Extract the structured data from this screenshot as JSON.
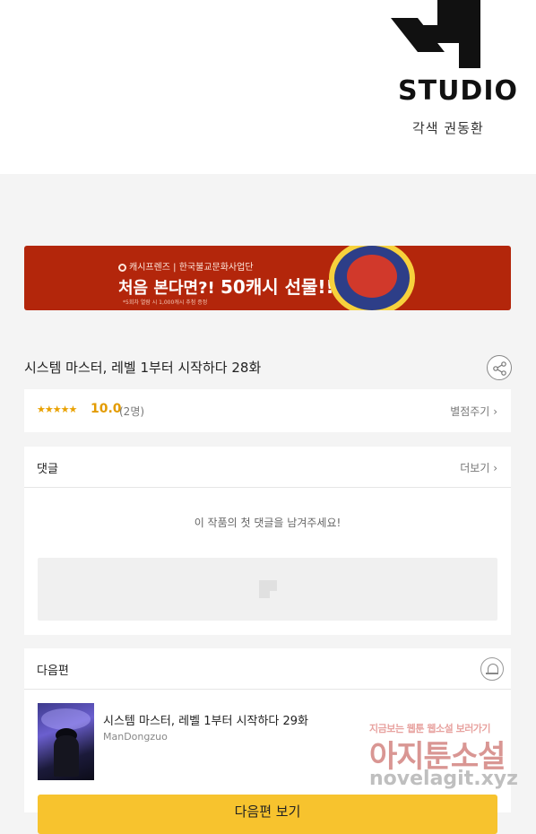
{
  "header": {
    "studio_name": "STUDIO",
    "credit": "각색 권동환"
  },
  "banner": {
    "brand_line": "캐시프렌즈 | 한국불교문화사업단",
    "headline_prefix": "처음 본다면?!",
    "headline_emphasis": "50캐시 선물!!",
    "fine_print": "*5회차 열람 시 1,000캐시 추첨 증정"
  },
  "episode": {
    "title": "시스템 마스터, 레벨 1부터 시작하다 28화"
  },
  "rating": {
    "stars": "★★★★★",
    "score": "10.0",
    "count": "(2명)",
    "rate_link": "별점주기"
  },
  "comments": {
    "title": "댓글",
    "more_label": "더보기",
    "empty_message": "이 작품의 첫 댓글을 남겨주세요!"
  },
  "next_episode": {
    "section_title": "다음편",
    "title": "시스템 마스터, 레벨 1부터 시작하다 29화",
    "author": "ManDongzuo",
    "button_label": "다음편 보기"
  },
  "watermark": {
    "tagline": "지금보는 웹툰 웹소설 보러가기",
    "site_name": "아지툰소설",
    "url": "novelagit.xyz"
  },
  "colors": {
    "banner_bg": "#b3260b",
    "accent_yellow": "#f7c32e",
    "star_color": "#e9a100"
  }
}
